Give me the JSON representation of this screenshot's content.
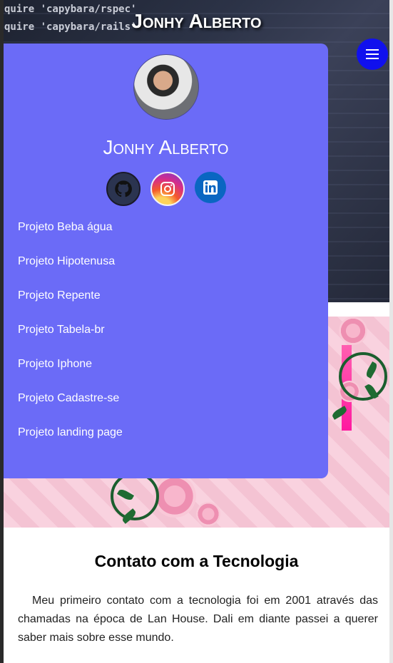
{
  "header": {
    "title": "Jonhy Alberto",
    "code_lines": [
      "quire 'capybara/rspec'",
      "quire 'capybara/rails'"
    ]
  },
  "menu_button": {
    "icon": "hamburger-menu-icon"
  },
  "sidebar": {
    "name": "Jonhy Alberto",
    "avatar": "profile-avatar",
    "socials": [
      {
        "name": "github-icon"
      },
      {
        "name": "instagram-icon"
      },
      {
        "name": "linkedin-icon"
      }
    ],
    "links": [
      "Projeto Beba água",
      "Projeto Hipotenusa",
      "Projeto Repente",
      "Projeto Tabela-br",
      "Projeto Iphone",
      "Projeto Cadastre-se",
      "Projeto landing page"
    ]
  },
  "content": {
    "heading": "Contato com a Tecnologia",
    "paragraph": "Meu primeiro contato com a tecnologia foi em 2001 através das chamadas na época de Lan House. Dali em diante passei a querer saber mais sobre esse mundo."
  },
  "colors": {
    "sidebar_bg": "#6b6bf7",
    "menu_button": "#1010ee"
  }
}
